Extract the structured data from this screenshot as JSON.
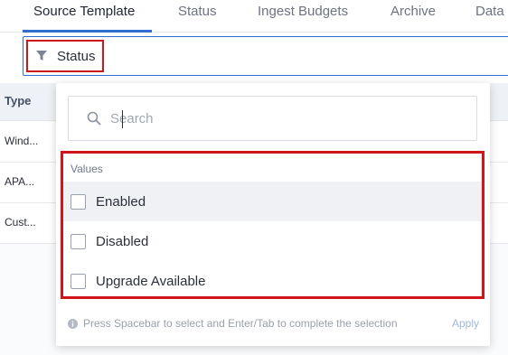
{
  "tabs": [
    {
      "label": "Source Template"
    },
    {
      "label": "Status"
    },
    {
      "label": "Ingest Budgets"
    },
    {
      "label": "Archive"
    },
    {
      "label": "Data"
    }
  ],
  "filter": {
    "chip_label": "Status"
  },
  "table": {
    "header_type": "Type",
    "rows": [
      "Wind...",
      "APA...",
      "Cust..."
    ]
  },
  "dropdown": {
    "search_placeholder": "Search",
    "values_title": "Values",
    "options": [
      {
        "label": "Enabled",
        "checked": false
      },
      {
        "label": "Disabled",
        "checked": false
      },
      {
        "label": "Upgrade Available",
        "checked": false
      }
    ],
    "hint": "Press Spacebar to select and Enter/Tab to complete the selection",
    "apply_label": "Apply"
  },
  "colors": {
    "accent": "#2f6fd1",
    "highlight_outline": "#d0151b"
  }
}
